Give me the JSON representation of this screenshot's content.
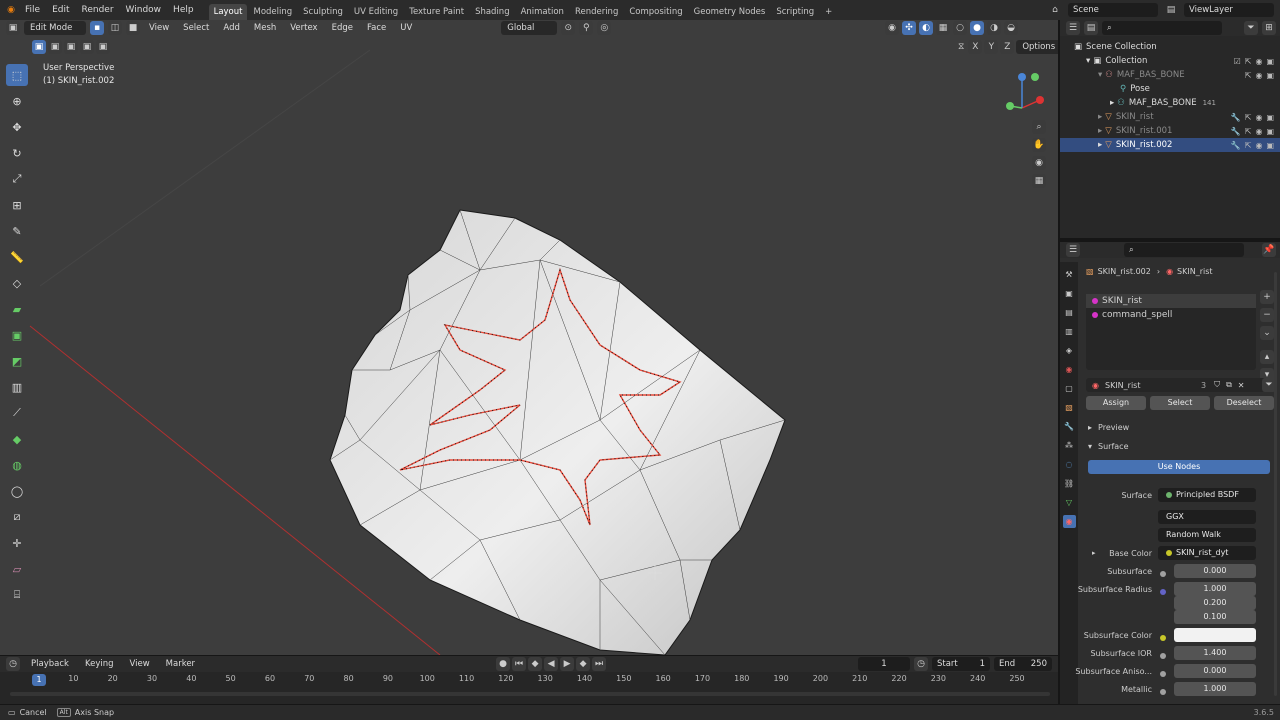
{
  "topbar": {
    "menus": [
      "File",
      "Edit",
      "Render",
      "Window",
      "Help"
    ],
    "workspaces": [
      "Layout",
      "Modeling",
      "Sculpting",
      "UV Editing",
      "Texture Paint",
      "Shading",
      "Animation",
      "Rendering",
      "Compositing",
      "Geometry Nodes",
      "Scripting"
    ],
    "active_workspace": "Layout",
    "add_tab": "+",
    "scene": "Scene",
    "view_layer": "ViewLayer"
  },
  "viewport": {
    "mode": "Edit Mode",
    "menus": [
      "View",
      "Select",
      "Add",
      "Mesh",
      "Vertex",
      "Edge",
      "Face",
      "UV"
    ],
    "transform_orientation": "Global",
    "axes": [
      "X",
      "Y",
      "Z"
    ],
    "options": "Options",
    "view_name": "User Perspective",
    "object_name": "(1) SKIN_rist.002"
  },
  "outliner": {
    "rows": [
      {
        "label": "Scene Collection",
        "indent": 0
      },
      {
        "label": "Collection",
        "indent": 1
      },
      {
        "label": "MAF_BAS_BONE",
        "indent": 2
      },
      {
        "label": "Pose",
        "indent": 3
      },
      {
        "label": "MAF_BAS_BONE",
        "indent": 3,
        "badge": "141"
      },
      {
        "label": "SKIN_rist",
        "indent": 2
      },
      {
        "label": "SKIN_rist.001",
        "indent": 2
      },
      {
        "label": "SKIN_rist.002",
        "indent": 2,
        "selected": true
      }
    ]
  },
  "properties": {
    "breadcrumb_object": "SKIN_rist.002",
    "breadcrumb_material": "SKIN_rist",
    "slots": [
      {
        "name": "SKIN_rist",
        "color": "#d633c8"
      },
      {
        "name": "command_spell",
        "color": "#d633c8"
      }
    ],
    "material_name": "SKIN_rist",
    "material_users": "3",
    "assign": "Assign",
    "select": "Select",
    "deselect": "Deselect",
    "preview": "Preview",
    "surface_panel": "Surface",
    "use_nodes": "Use Nodes",
    "surface_label": "Surface",
    "surface_value": "Principled BSDF",
    "distribution": "GGX",
    "subsurface_method": "Random Walk",
    "fields": [
      {
        "label": "Base Color",
        "value": "SKIN_rist_dyt",
        "type": "link"
      },
      {
        "label": "Subsurface",
        "value": "0.000",
        "type": "num"
      },
      {
        "label": "Subsurface Radius",
        "value": "1.000",
        "type": "num"
      },
      {
        "label": "",
        "value": "0.200",
        "type": "num"
      },
      {
        "label": "",
        "value": "0.100",
        "type": "num"
      },
      {
        "label": "Subsurface Color",
        "value": "",
        "type": "color"
      },
      {
        "label": "Subsurface IOR",
        "value": "1.400",
        "type": "num"
      },
      {
        "label": "Subsurface Aniso...",
        "value": "0.000",
        "type": "num"
      },
      {
        "label": "Metallic",
        "value": "1.000",
        "type": "num"
      }
    ],
    "accent": "#4772b3"
  },
  "timeline": {
    "menus": [
      "Playback",
      "Keying",
      "View",
      "Marker"
    ],
    "current_frame": "1",
    "start_label": "Start",
    "start": "1",
    "end_label": "End",
    "end": "250",
    "ticks": [
      "1",
      "10",
      "20",
      "30",
      "40",
      "50",
      "60",
      "70",
      "80",
      "90",
      "100",
      "110",
      "120",
      "130",
      "140",
      "150",
      "160",
      "170",
      "180",
      "190",
      "200",
      "210",
      "220",
      "230",
      "240",
      "250"
    ]
  },
  "status": {
    "cancel": "Cancel",
    "axis_snap": "Axis Snap",
    "version": "3.6.5"
  }
}
